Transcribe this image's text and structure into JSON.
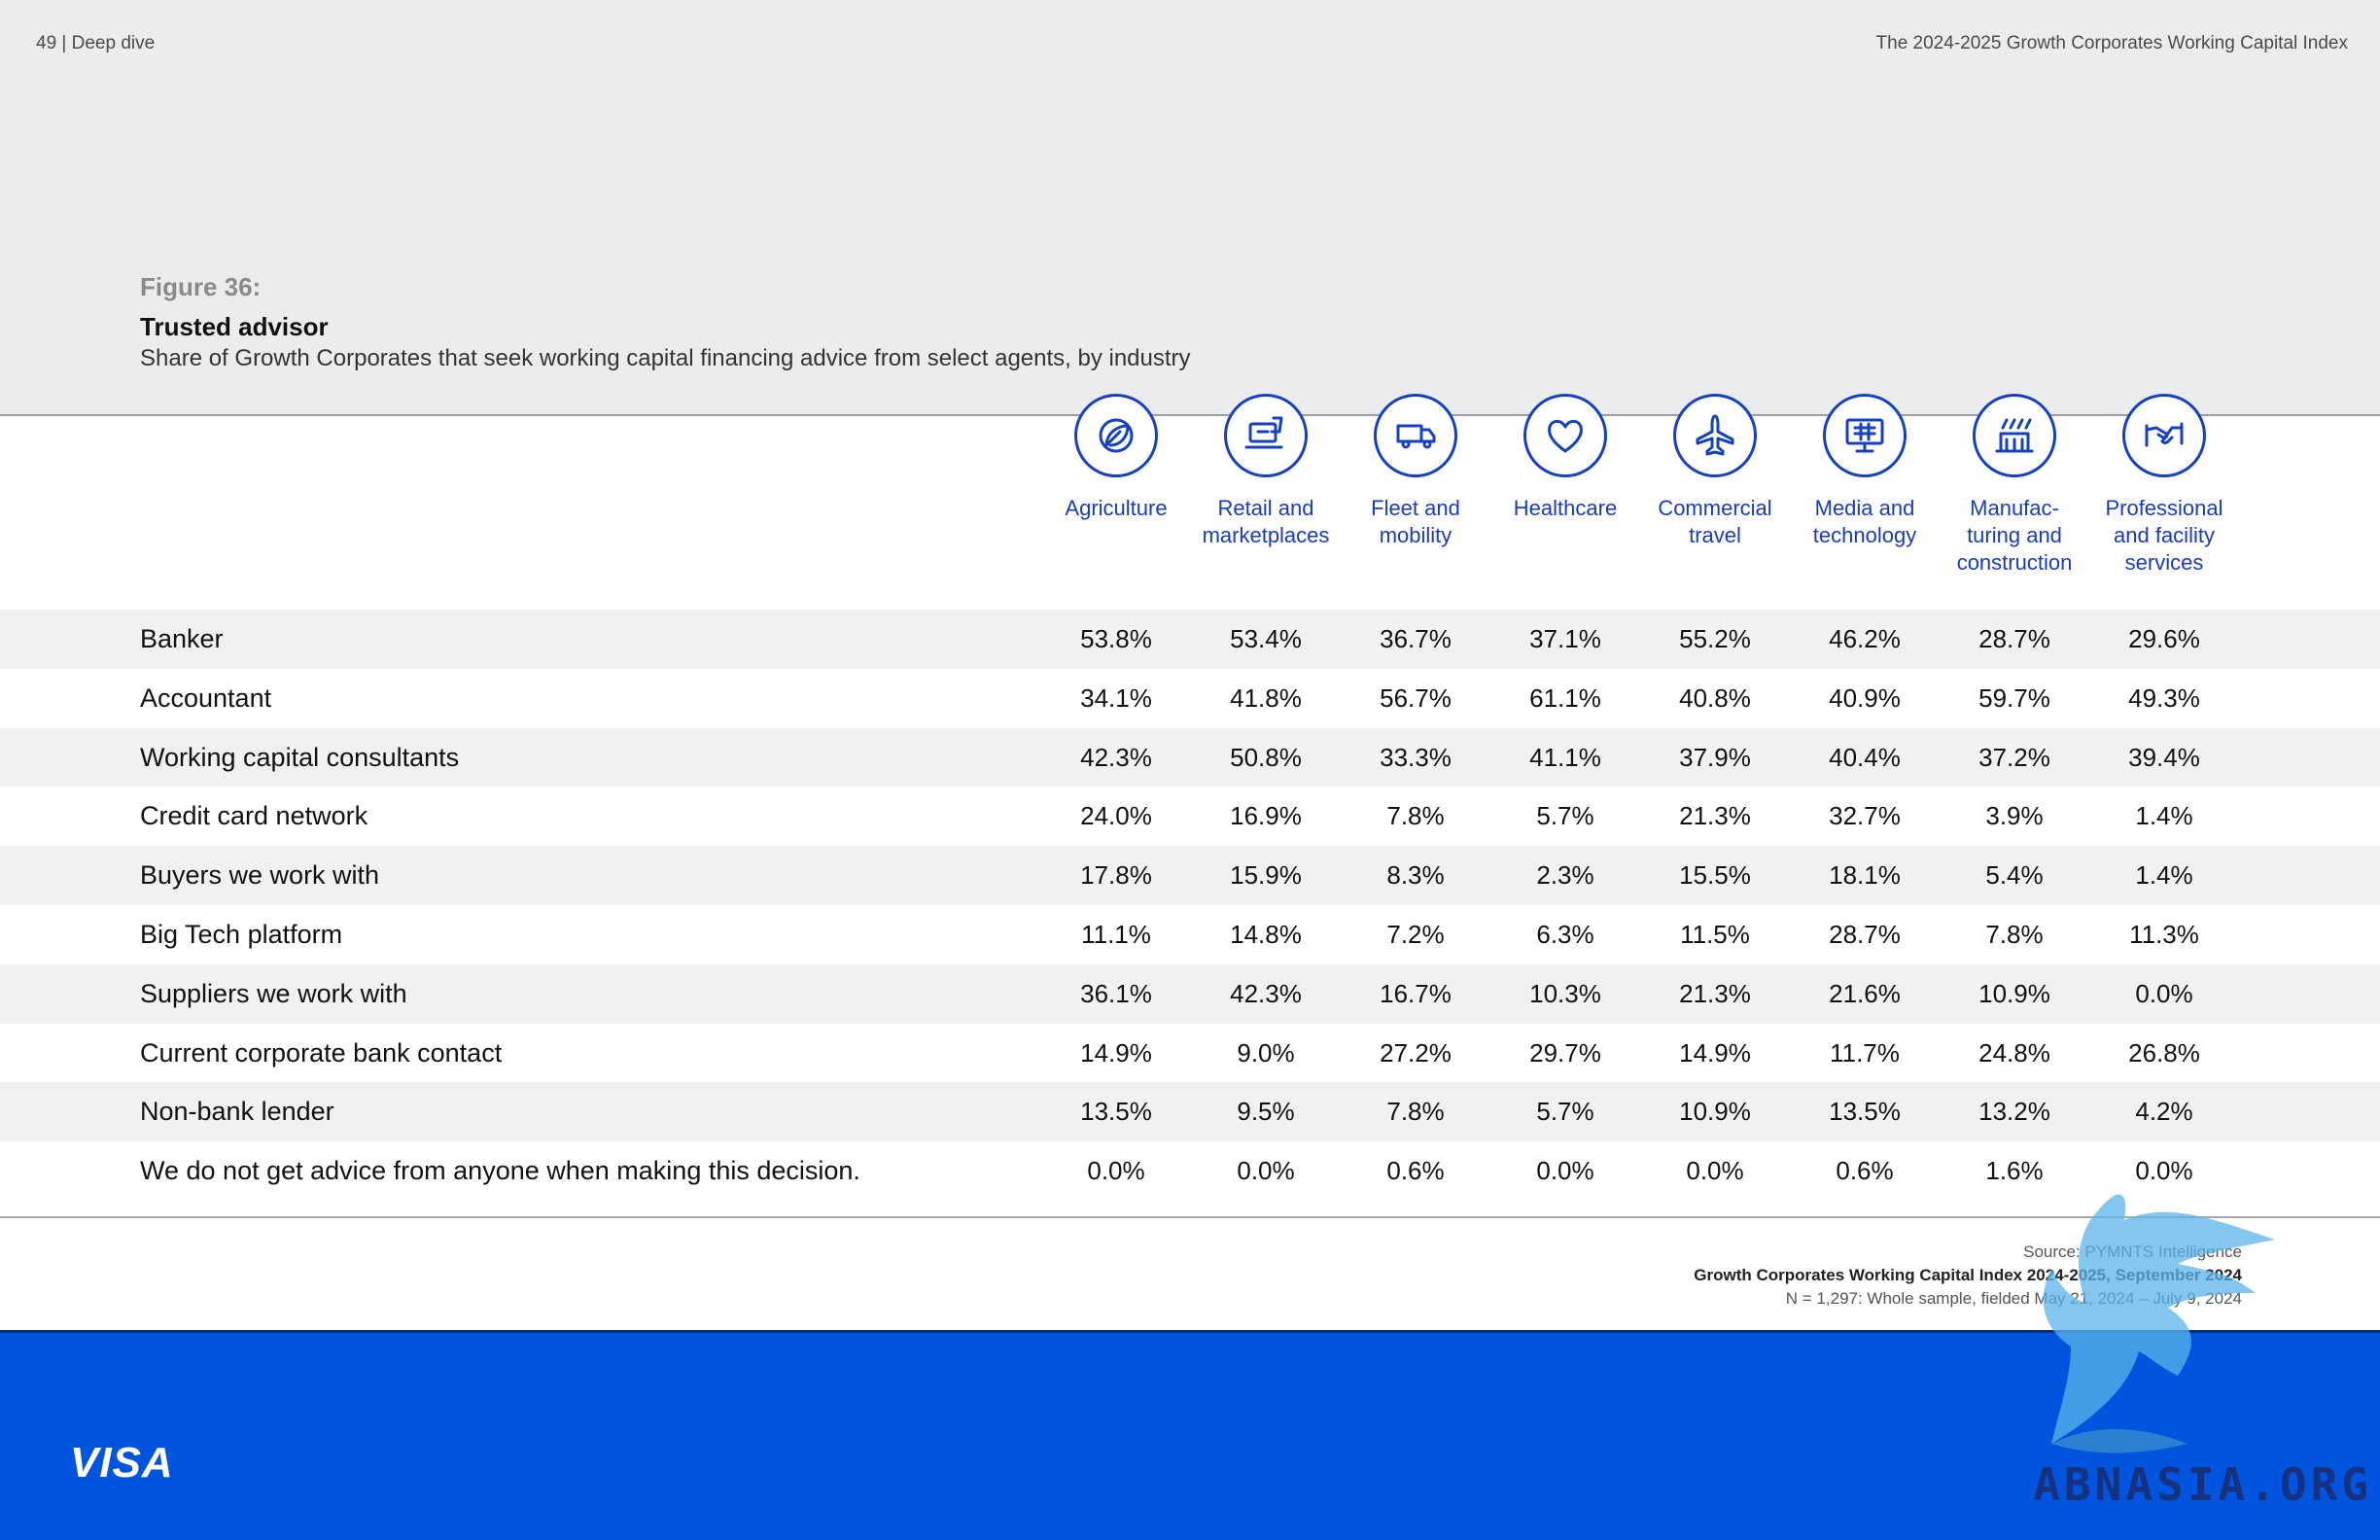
{
  "header": {
    "left": "49  |  Deep dive",
    "right": "The 2024-2025 Growth Corporates Working Capital Index"
  },
  "figure": {
    "number": "Figure 36:",
    "title": "Trusted advisor",
    "subtitle": "Share of Growth Corporates that seek working capital financing advice from select agents, by industry"
  },
  "industries": [
    {
      "label": "Agriculture",
      "icon": "leaf-icon"
    },
    {
      "label": "Retail and\nmarketplaces",
      "icon": "shopping-cart-icon"
    },
    {
      "label": "Fleet and\nmobility",
      "icon": "truck-icon"
    },
    {
      "label": "Healthcare",
      "icon": "heart-icon"
    },
    {
      "label": "Commercial\ntravel",
      "icon": "airplane-icon"
    },
    {
      "label": "Media and\ntechnology",
      "icon": "monitor-icon"
    },
    {
      "label": "Manufac-\nturing and\nconstruction",
      "icon": "factory-icon"
    },
    {
      "label": "Professional\nand facility\nservices",
      "icon": "handshake-icon"
    }
  ],
  "rows": [
    {
      "label": "Banker",
      "values": [
        "53.8%",
        "53.4%",
        "36.7%",
        "37.1%",
        "55.2%",
        "46.2%",
        "28.7%",
        "29.6%"
      ]
    },
    {
      "label": "Accountant",
      "values": [
        "34.1%",
        "41.8%",
        "56.7%",
        "61.1%",
        "40.8%",
        "40.9%",
        "59.7%",
        "49.3%"
      ]
    },
    {
      "label": "Working capital consultants",
      "values": [
        "42.3%",
        "50.8%",
        "33.3%",
        "41.1%",
        "37.9%",
        "40.4%",
        "37.2%",
        "39.4%"
      ]
    },
    {
      "label": "Credit card network",
      "values": [
        "24.0%",
        "16.9%",
        "7.8%",
        "5.7%",
        "21.3%",
        "32.7%",
        "3.9%",
        "1.4%"
      ]
    },
    {
      "label": "Buyers we work with",
      "values": [
        "17.8%",
        "15.9%",
        "8.3%",
        "2.3%",
        "15.5%",
        "18.1%",
        "5.4%",
        "1.4%"
      ]
    },
    {
      "label": "Big Tech platform",
      "values": [
        "11.1%",
        "14.8%",
        "7.2%",
        "6.3%",
        "11.5%",
        "28.7%",
        "7.8%",
        "11.3%"
      ]
    },
    {
      "label": "Suppliers we work with",
      "values": [
        "36.1%",
        "42.3%",
        "16.7%",
        "10.3%",
        "21.3%",
        "21.6%",
        "10.9%",
        "0.0%"
      ]
    },
    {
      "label": "Current corporate bank contact",
      "values": [
        "14.9%",
        "9.0%",
        "27.2%",
        "29.7%",
        "14.9%",
        "11.7%",
        "24.8%",
        "26.8%"
      ]
    },
    {
      "label": "Non-bank lender",
      "values": [
        "13.5%",
        "9.5%",
        "7.8%",
        "5.7%",
        "10.9%",
        "13.5%",
        "13.2%",
        "4.2%"
      ]
    },
    {
      "label": "We do not get advice from anyone when making this decision.",
      "values": [
        "0.0%",
        "0.0%",
        "0.6%",
        "0.0%",
        "0.0%",
        "0.6%",
        "1.6%",
        "0.0%"
      ]
    }
  ],
  "source": {
    "line1": "Source: PYMNTS Intelligence",
    "line2": "Growth Corporates Working Capital Index 2024-2025, September 2024",
    "line3": "N = 1,297: Whole sample, fielded May 21, 2024 – July 9, 2024"
  },
  "footer": {
    "logo": "VISA",
    "watermark": "ABNASIA.ORG"
  },
  "colors": {
    "accent_blue": "#1a3bbf",
    "footer_blue": "#0054dd",
    "top_band": "#ebecee"
  }
}
